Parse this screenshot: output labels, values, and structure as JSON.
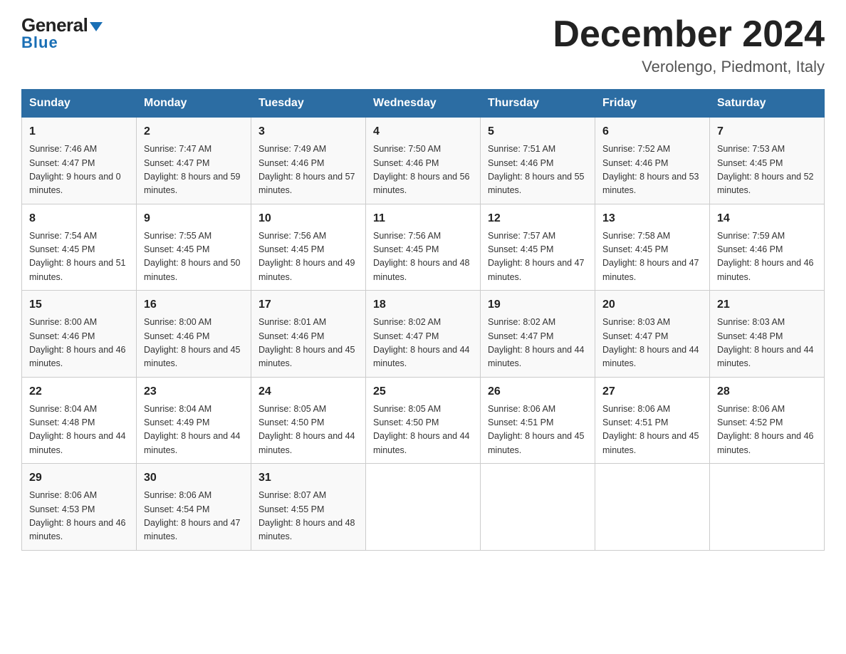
{
  "header": {
    "logo_general": "General",
    "logo_blue": "Blue",
    "month_title": "December 2024",
    "location": "Verolengo, Piedmont, Italy"
  },
  "columns": [
    "Sunday",
    "Monday",
    "Tuesday",
    "Wednesday",
    "Thursday",
    "Friday",
    "Saturday"
  ],
  "weeks": [
    [
      {
        "day": "1",
        "sunrise": "Sunrise: 7:46 AM",
        "sunset": "Sunset: 4:47 PM",
        "daylight": "Daylight: 9 hours and 0 minutes."
      },
      {
        "day": "2",
        "sunrise": "Sunrise: 7:47 AM",
        "sunset": "Sunset: 4:47 PM",
        "daylight": "Daylight: 8 hours and 59 minutes."
      },
      {
        "day": "3",
        "sunrise": "Sunrise: 7:49 AM",
        "sunset": "Sunset: 4:46 PM",
        "daylight": "Daylight: 8 hours and 57 minutes."
      },
      {
        "day": "4",
        "sunrise": "Sunrise: 7:50 AM",
        "sunset": "Sunset: 4:46 PM",
        "daylight": "Daylight: 8 hours and 56 minutes."
      },
      {
        "day": "5",
        "sunrise": "Sunrise: 7:51 AM",
        "sunset": "Sunset: 4:46 PM",
        "daylight": "Daylight: 8 hours and 55 minutes."
      },
      {
        "day": "6",
        "sunrise": "Sunrise: 7:52 AM",
        "sunset": "Sunset: 4:46 PM",
        "daylight": "Daylight: 8 hours and 53 minutes."
      },
      {
        "day": "7",
        "sunrise": "Sunrise: 7:53 AM",
        "sunset": "Sunset: 4:45 PM",
        "daylight": "Daylight: 8 hours and 52 minutes."
      }
    ],
    [
      {
        "day": "8",
        "sunrise": "Sunrise: 7:54 AM",
        "sunset": "Sunset: 4:45 PM",
        "daylight": "Daylight: 8 hours and 51 minutes."
      },
      {
        "day": "9",
        "sunrise": "Sunrise: 7:55 AM",
        "sunset": "Sunset: 4:45 PM",
        "daylight": "Daylight: 8 hours and 50 minutes."
      },
      {
        "day": "10",
        "sunrise": "Sunrise: 7:56 AM",
        "sunset": "Sunset: 4:45 PM",
        "daylight": "Daylight: 8 hours and 49 minutes."
      },
      {
        "day": "11",
        "sunrise": "Sunrise: 7:56 AM",
        "sunset": "Sunset: 4:45 PM",
        "daylight": "Daylight: 8 hours and 48 minutes."
      },
      {
        "day": "12",
        "sunrise": "Sunrise: 7:57 AM",
        "sunset": "Sunset: 4:45 PM",
        "daylight": "Daylight: 8 hours and 47 minutes."
      },
      {
        "day": "13",
        "sunrise": "Sunrise: 7:58 AM",
        "sunset": "Sunset: 4:45 PM",
        "daylight": "Daylight: 8 hours and 47 minutes."
      },
      {
        "day": "14",
        "sunrise": "Sunrise: 7:59 AM",
        "sunset": "Sunset: 4:46 PM",
        "daylight": "Daylight: 8 hours and 46 minutes."
      }
    ],
    [
      {
        "day": "15",
        "sunrise": "Sunrise: 8:00 AM",
        "sunset": "Sunset: 4:46 PM",
        "daylight": "Daylight: 8 hours and 46 minutes."
      },
      {
        "day": "16",
        "sunrise": "Sunrise: 8:00 AM",
        "sunset": "Sunset: 4:46 PM",
        "daylight": "Daylight: 8 hours and 45 minutes."
      },
      {
        "day": "17",
        "sunrise": "Sunrise: 8:01 AM",
        "sunset": "Sunset: 4:46 PM",
        "daylight": "Daylight: 8 hours and 45 minutes."
      },
      {
        "day": "18",
        "sunrise": "Sunrise: 8:02 AM",
        "sunset": "Sunset: 4:47 PM",
        "daylight": "Daylight: 8 hours and 44 minutes."
      },
      {
        "day": "19",
        "sunrise": "Sunrise: 8:02 AM",
        "sunset": "Sunset: 4:47 PM",
        "daylight": "Daylight: 8 hours and 44 minutes."
      },
      {
        "day": "20",
        "sunrise": "Sunrise: 8:03 AM",
        "sunset": "Sunset: 4:47 PM",
        "daylight": "Daylight: 8 hours and 44 minutes."
      },
      {
        "day": "21",
        "sunrise": "Sunrise: 8:03 AM",
        "sunset": "Sunset: 4:48 PM",
        "daylight": "Daylight: 8 hours and 44 minutes."
      }
    ],
    [
      {
        "day": "22",
        "sunrise": "Sunrise: 8:04 AM",
        "sunset": "Sunset: 4:48 PM",
        "daylight": "Daylight: 8 hours and 44 minutes."
      },
      {
        "day": "23",
        "sunrise": "Sunrise: 8:04 AM",
        "sunset": "Sunset: 4:49 PM",
        "daylight": "Daylight: 8 hours and 44 minutes."
      },
      {
        "day": "24",
        "sunrise": "Sunrise: 8:05 AM",
        "sunset": "Sunset: 4:50 PM",
        "daylight": "Daylight: 8 hours and 44 minutes."
      },
      {
        "day": "25",
        "sunrise": "Sunrise: 8:05 AM",
        "sunset": "Sunset: 4:50 PM",
        "daylight": "Daylight: 8 hours and 44 minutes."
      },
      {
        "day": "26",
        "sunrise": "Sunrise: 8:06 AM",
        "sunset": "Sunset: 4:51 PM",
        "daylight": "Daylight: 8 hours and 45 minutes."
      },
      {
        "day": "27",
        "sunrise": "Sunrise: 8:06 AM",
        "sunset": "Sunset: 4:51 PM",
        "daylight": "Daylight: 8 hours and 45 minutes."
      },
      {
        "day": "28",
        "sunrise": "Sunrise: 8:06 AM",
        "sunset": "Sunset: 4:52 PM",
        "daylight": "Daylight: 8 hours and 46 minutes."
      }
    ],
    [
      {
        "day": "29",
        "sunrise": "Sunrise: 8:06 AM",
        "sunset": "Sunset: 4:53 PM",
        "daylight": "Daylight: 8 hours and 46 minutes."
      },
      {
        "day": "30",
        "sunrise": "Sunrise: 8:06 AM",
        "sunset": "Sunset: 4:54 PM",
        "daylight": "Daylight: 8 hours and 47 minutes."
      },
      {
        "day": "31",
        "sunrise": "Sunrise: 8:07 AM",
        "sunset": "Sunset: 4:55 PM",
        "daylight": "Daylight: 8 hours and 48 minutes."
      },
      null,
      null,
      null,
      null
    ]
  ]
}
